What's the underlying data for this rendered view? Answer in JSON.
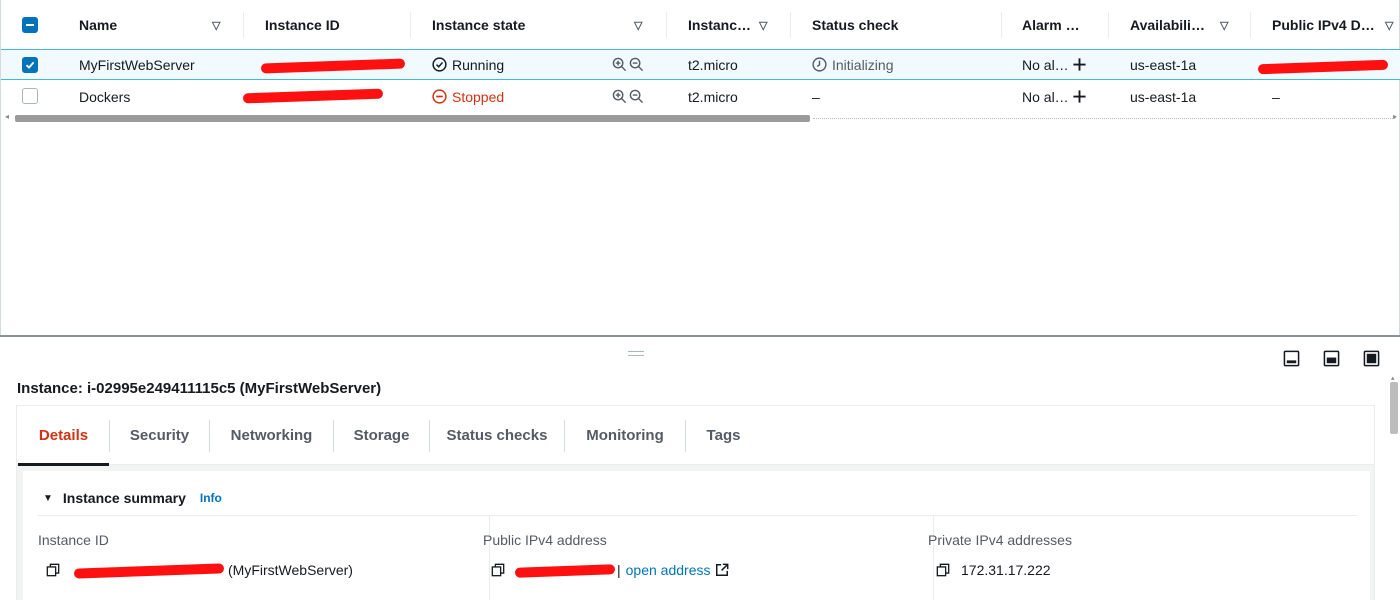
{
  "table": {
    "columns": [
      {
        "label": "Name"
      },
      {
        "label": "Instance ID"
      },
      {
        "label": "Instance state"
      },
      {
        "label": "Instanc…"
      },
      {
        "label": "Status check"
      },
      {
        "label": "Alarm …"
      },
      {
        "label": "Availabili…"
      },
      {
        "label": "Public IPv4 D…"
      }
    ],
    "rows": [
      {
        "name": "MyFirstWebServer",
        "instance_id": "i-02995e249411115c5",
        "state": "Running",
        "type": "t2.micro",
        "status_check": "Initializing",
        "alarm": "No al…",
        "az": "us-east-1a",
        "public_dns": ""
      },
      {
        "name": "Dockers",
        "instance_id": "",
        "state": "Stopped",
        "type": "t2.micro",
        "status_check": "–",
        "alarm": "No al…",
        "az": "us-east-1a",
        "public_dns": "–"
      }
    ]
  },
  "detail": {
    "title": "Instance: i-02995e249411115c5 (MyFirstWebServer)",
    "tabs": [
      {
        "label": "Details"
      },
      {
        "label": "Security"
      },
      {
        "label": "Networking"
      },
      {
        "label": "Storage"
      },
      {
        "label": "Status checks"
      },
      {
        "label": "Monitoring"
      },
      {
        "label": "Tags"
      }
    ],
    "summary": {
      "heading": "Instance summary",
      "info_link": "Info",
      "instance_id_label": "Instance ID",
      "instance_id_suffix": "(MyFirstWebServer)",
      "public_ip_label": "Public IPv4 address",
      "open_address": "open address",
      "private_ip_label": "Private IPv4 addresses",
      "private_ip": "172.31.17.222"
    }
  },
  "colors": {
    "accent_blue": "#0073bb",
    "stopped_red": "#d13212",
    "active_tab": "#d13212"
  },
  "icons": [
    "checkbox-icon",
    "sort-caret-icon",
    "check-circle-icon",
    "minus-circle-icon",
    "zoom-in-icon",
    "zoom-out-icon",
    "clock-icon",
    "plus-icon",
    "copy-icon",
    "external-link-icon",
    "panel-layout-icon"
  ]
}
